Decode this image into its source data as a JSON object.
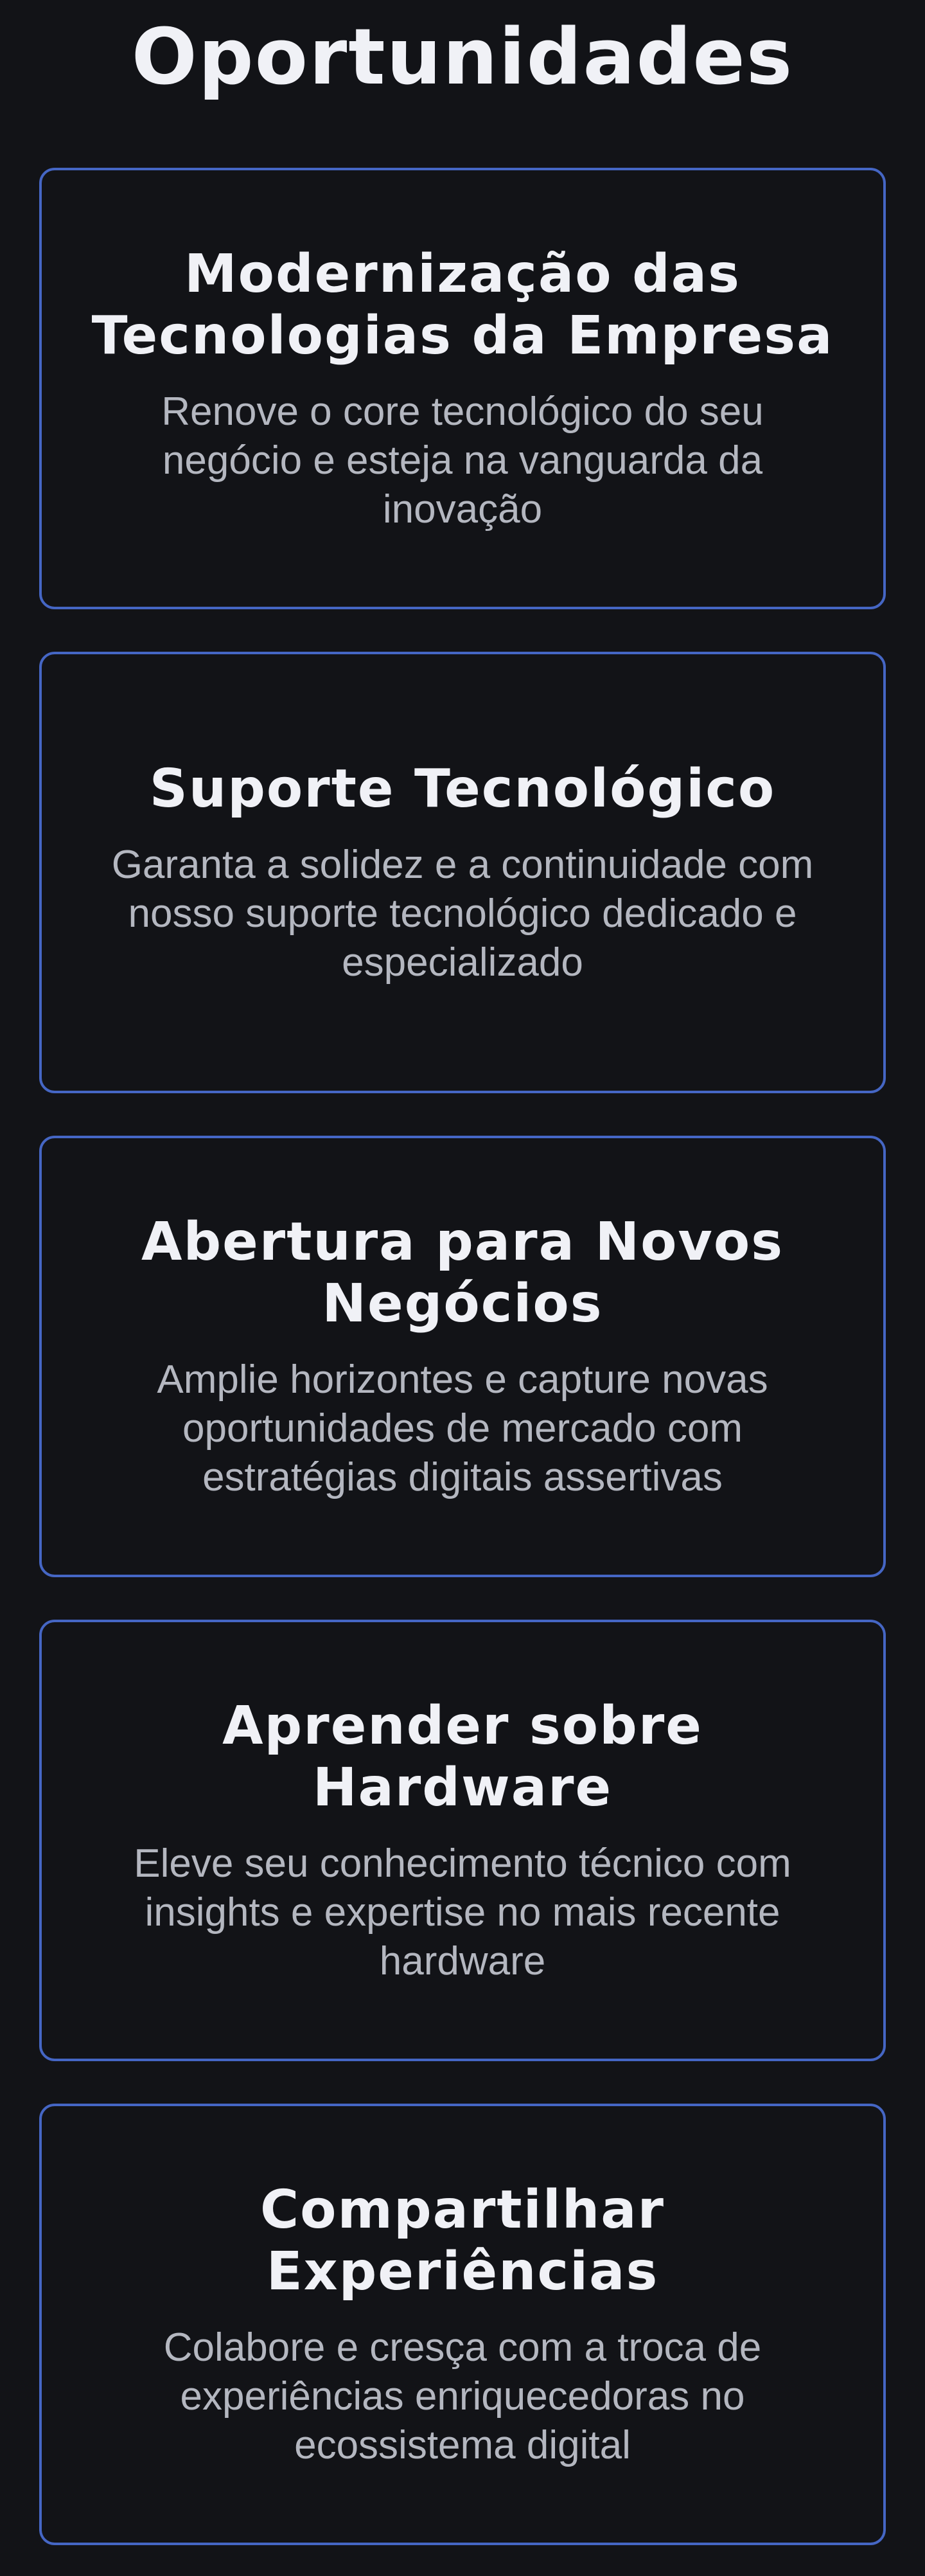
{
  "section": {
    "title": "Oportunidades"
  },
  "cards": [
    {
      "title": "Modernização das Tecnologias da Empresa",
      "description": "Renove o core tecnológico do seu negócio e esteja na vanguarda da inovação"
    },
    {
      "title": "Suporte Tecnológico",
      "description": "Garanta a solidez e a continuidade com nosso suporte tecnológico dedicado e especializado"
    },
    {
      "title": "Abertura para Novos Negócios",
      "description": "Amplie horizontes e capture novas oportunidades de mercado com estratégias digitais assertivas"
    },
    {
      "title": "Aprender sobre Hardware",
      "description": "Eleve seu conhecimento técnico com insights e expertise no mais recente hardware"
    },
    {
      "title": "Compartilhar Experiências",
      "description": "Colabore e cresça com a troca de experiências enriquecedoras no ecossistema digital"
    }
  ],
  "colors": {
    "background": "#121317",
    "card_border": "#4566c4",
    "title_text": "#f0f1f6",
    "body_text": "#b4b7c0"
  }
}
